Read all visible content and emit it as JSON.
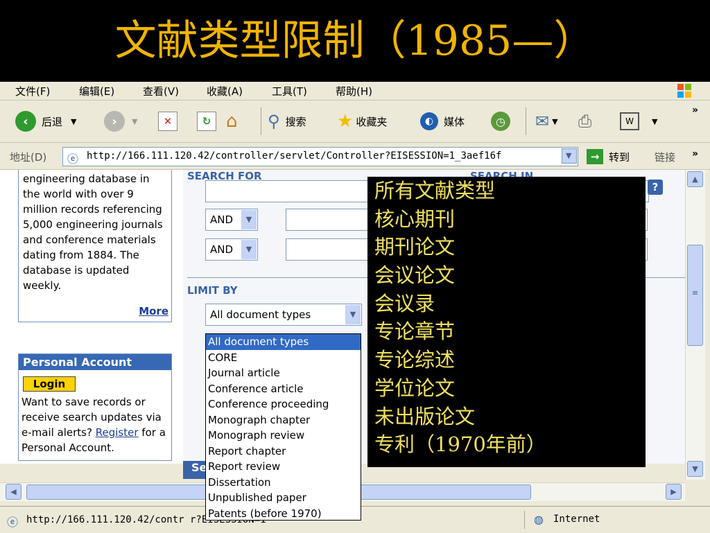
{
  "slide": {
    "title": "文献类型限制（1985—）"
  },
  "browser": {
    "menu": [
      "文件(F)",
      "编辑(E)",
      "查看(V)",
      "收藏(A)",
      "工具(T)",
      "帮助(H)"
    ],
    "toolbar": {
      "back": "后退",
      "search": "搜索",
      "favorites": "收藏夹",
      "media": "媒体"
    },
    "address": {
      "label": "地址(D)",
      "url": "http://166.111.120.42/controller/servlet/Controller?EISESSION=1_3aef16f",
      "go": "转到",
      "links": "链接"
    },
    "status": {
      "text": "http://166.111.120.42/contr                     r?EISESSION=1",
      "zone": "Internet"
    }
  },
  "page": {
    "left_text": "engineering database in the world with over 9 million records referencing 5,000 engineering journals and conference materials dating from 1884. The database is updated weekly.",
    "more_link": "More",
    "account": {
      "heading": "Personal Account",
      "login": "Login",
      "text_before": "Want to save records or receive search updates via e-mail alerts?",
      "register": "Register",
      "text_after": "for a Personal Account."
    },
    "search_for": "SEARCH FOR",
    "search_in": "SEARCH IN",
    "bool1": "AND",
    "bool2": "AND",
    "limit_by": "LIMIT BY",
    "doctype_selected": "All document types",
    "doctype_options": [
      "All document types",
      "CORE",
      "Journal article",
      "Conference article",
      "Conference proceeding",
      "Monograph chapter",
      "Monograph review",
      "Report chapter",
      "Report review",
      "Dissertation",
      "Unpublished paper",
      "Patents (before 1970)"
    ],
    "se_tab": "Se"
  },
  "overlay": {
    "items": [
      "所有文献类型",
      "核心期刊",
      "期刊论文",
      "会议论文",
      "会议录",
      "专论章节",
      "专论综述",
      "学位论文",
      "未出版论文",
      "专利（1970年前）"
    ]
  },
  "colors": {
    "title": "#f0b400",
    "overlay_text": "#f0e060",
    "selection": "#316ac5"
  }
}
